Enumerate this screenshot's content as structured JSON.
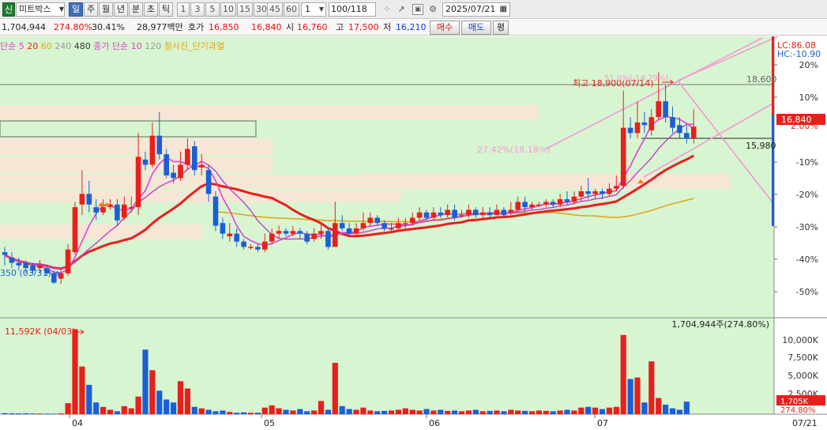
{
  "toolbar": {
    "code_badge": "신",
    "stock_name": "미트박스",
    "periods": [
      "일",
      "주",
      "월",
      "년",
      "분",
      "초",
      "틱"
    ],
    "selected_period": "일",
    "intervals": [
      "1",
      "3",
      "5",
      "10",
      "15",
      "30",
      "45",
      "60"
    ],
    "interval_input": "1",
    "count_value": "100",
    "count_total": "/118",
    "date": "2025/07/21"
  },
  "quote": {
    "volume": "1,704,944",
    "volume_ratio": "274.80%",
    "turnover": "30.41%",
    "amount": "28,977백만",
    "ask_label": "호가",
    "ask": "16,850",
    "bid": "16,840",
    "open_label": "시",
    "open": "16,760",
    "high_label": "고",
    "high": "17,500",
    "low_label": "저",
    "low": "16,210",
    "buy_label": "매수",
    "sell_label": "매도",
    "eval_label": "평"
  },
  "legend": {
    "ma_label": "단순",
    "ma5": "5",
    "ma20": "20",
    "ma60": "60",
    "ma240": "240",
    "ma480": "480",
    "close_ma_label": "종가 단순",
    "ma10": "10",
    "ma120": "120",
    "pattern_label": "청사진_단기과열"
  },
  "chart_data": {
    "type": "candlestick",
    "x_month_labels": [
      "04",
      "05",
      "06",
      "07",
      "07/21"
    ],
    "y_pct_ticks": [
      "20%",
      "10%",
      "2.00%",
      "-10%",
      "-20%",
      "-30%",
      "-40%",
      "-50%"
    ],
    "volume_ticks": [
      "10,000K",
      "7,500K",
      "5,000K",
      "2,500K"
    ],
    "candles": [
      [
        12.1,
        12.0,
        12.3,
        11.6
      ],
      [
        11.9,
        11.7,
        12.1,
        11.5
      ],
      [
        11.7,
        11.6,
        11.9,
        11.4
      ],
      [
        11.7,
        11.5,
        11.8,
        11.3
      ],
      [
        11.6,
        11.4,
        11.7,
        11.3
      ],
      [
        11.5,
        11.6,
        11.8,
        11.3
      ],
      [
        11.5,
        11.3,
        11.6,
        11.2
      ],
      [
        11.3,
        10.95,
        11.4,
        10.9
      ],
      [
        11.1,
        11.3,
        11.5,
        10.9
      ],
      [
        11.3,
        12.2,
        12.4,
        11.2
      ],
      [
        12.1,
        13.8,
        14.0,
        12.0
      ],
      [
        13.9,
        14.3,
        15.2,
        13.5
      ],
      [
        14.3,
        13.9,
        14.8,
        13.6
      ],
      [
        13.8,
        13.6,
        14.1,
        13.3
      ],
      [
        13.6,
        13.8,
        14.1,
        13.5
      ],
      [
        13.8,
        13.9,
        14.1,
        13.7
      ],
      [
        13.9,
        13.3,
        14.1,
        13.1
      ],
      [
        13.4,
        13.9,
        14.2,
        13.3
      ],
      [
        13.8,
        13.8,
        14.2,
        13.6
      ],
      [
        13.8,
        15.7,
        16.6,
        13.5
      ],
      [
        15.6,
        15.4,
        15.9,
        15.2
      ],
      [
        15.4,
        16.5,
        17.0,
        15.3
      ],
      [
        16.5,
        15.8,
        17.4,
        15.6
      ],
      [
        15.8,
        15.0,
        16.0,
        14.9
      ],
      [
        15.1,
        14.9,
        15.4,
        14.7
      ],
      [
        14.9,
        15.4,
        15.9,
        14.8
      ],
      [
        15.4,
        16.0,
        16.4,
        15.2
      ],
      [
        16.1,
        15.2,
        16.3,
        15.0
      ],
      [
        15.3,
        15.4,
        15.8,
        15.0
      ],
      [
        15.2,
        14.3,
        15.4,
        14.0
      ],
      [
        14.2,
        13.1,
        14.4,
        12.9
      ],
      [
        13.2,
        12.8,
        13.4,
        12.6
      ],
      [
        12.7,
        12.8,
        13.2,
        12.5
      ],
      [
        12.8,
        12.5,
        13.0,
        12.3
      ],
      [
        12.5,
        12.3,
        12.6,
        12.2
      ],
      [
        12.3,
        12.3,
        12.4,
        12.2
      ],
      [
        12.3,
        12.2,
        12.4,
        12.1
      ],
      [
        12.2,
        12.5,
        12.8,
        12.1
      ],
      [
        12.5,
        12.8,
        13.0,
        12.4
      ],
      [
        12.8,
        12.9,
        13.1,
        12.6
      ],
      [
        12.9,
        12.8,
        13.0,
        12.7
      ],
      [
        12.8,
        12.9,
        13.1,
        12.7
      ],
      [
        12.9,
        12.8,
        13.0,
        12.6
      ],
      [
        12.8,
        12.5,
        12.9,
        12.4
      ],
      [
        12.6,
        12.8,
        13.0,
        12.5
      ],
      [
        12.8,
        12.9,
        13.2,
        12.6
      ],
      [
        12.9,
        12.3,
        13.0,
        12.2
      ],
      [
        12.3,
        13.2,
        14.0,
        12.3
      ],
      [
        13.2,
        13.0,
        13.5,
        12.9
      ],
      [
        13.0,
        12.8,
        13.2,
        12.7
      ],
      [
        12.8,
        13.0,
        13.2,
        12.7
      ],
      [
        13.0,
        13.2,
        13.6,
        12.9
      ],
      [
        13.2,
        13.4,
        13.6,
        13.1
      ],
      [
        13.4,
        13.2,
        13.5,
        13.1
      ],
      [
        13.2,
        13.0,
        13.3,
        12.9
      ],
      [
        13.0,
        13.0,
        13.2,
        12.9
      ],
      [
        13.0,
        13.2,
        13.4,
        12.9
      ],
      [
        13.2,
        13.2,
        13.4,
        13.0
      ],
      [
        13.2,
        13.4,
        13.6,
        13.1
      ],
      [
        13.4,
        13.6,
        13.8,
        13.3
      ],
      [
        13.6,
        13.4,
        13.7,
        13.3
      ],
      [
        13.4,
        13.6,
        13.8,
        13.3
      ],
      [
        13.6,
        13.5,
        13.8,
        13.4
      ],
      [
        13.5,
        13.7,
        13.9,
        13.4
      ],
      [
        13.7,
        13.4,
        13.9,
        13.3
      ],
      [
        13.5,
        13.5,
        13.7,
        13.4
      ],
      [
        13.5,
        13.7,
        13.9,
        13.4
      ],
      [
        13.7,
        13.5,
        13.8,
        13.4
      ],
      [
        13.5,
        13.6,
        13.8,
        13.4
      ],
      [
        13.6,
        13.5,
        13.8,
        13.4
      ],
      [
        13.5,
        13.7,
        13.9,
        13.5
      ],
      [
        13.7,
        13.5,
        13.8,
        13.4
      ],
      [
        13.6,
        13.7,
        14.0,
        13.5
      ],
      [
        13.7,
        14.0,
        14.2,
        13.6
      ],
      [
        14.0,
        13.8,
        14.2,
        13.6
      ],
      [
        13.8,
        13.9,
        14.0,
        13.7
      ],
      [
        13.9,
        13.9,
        14.0,
        13.8
      ],
      [
        13.9,
        14.0,
        14.1,
        13.8
      ],
      [
        14.0,
        13.9,
        14.1,
        13.8
      ],
      [
        13.9,
        14.1,
        14.3,
        13.8
      ],
      [
        14.1,
        14.0,
        14.4,
        13.9
      ],
      [
        14.0,
        14.2,
        14.4,
        13.9
      ],
      [
        14.2,
        14.4,
        14.6,
        14.0
      ],
      [
        14.4,
        14.3,
        14.9,
        14.1
      ],
      [
        14.3,
        14.4,
        14.5,
        14.1
      ],
      [
        14.4,
        14.3,
        14.5,
        14.1
      ],
      [
        14.3,
        14.5,
        14.7,
        14.2
      ],
      [
        14.5,
        14.6,
        15.0,
        14.4
      ],
      [
        14.6,
        16.8,
        18.2,
        14.5
      ],
      [
        16.8,
        16.6,
        17.2,
        16.4
      ],
      [
        16.6,
        17.0,
        17.8,
        16.4
      ],
      [
        17.0,
        16.9,
        17.4,
        16.6
      ],
      [
        16.7,
        17.2,
        17.5,
        16.5
      ],
      [
        17.2,
        17.8,
        18.9,
        17.1
      ],
      [
        17.8,
        17.2,
        18.4,
        17.0
      ],
      [
        17.2,
        16.8,
        17.6,
        16.6
      ],
      [
        16.9,
        16.6,
        17.2,
        16.4
      ],
      [
        16.6,
        16.4,
        16.9,
        16.2
      ],
      [
        16.4,
        16.84,
        17.5,
        16.21
      ]
    ],
    "volume_k": [
      140,
      120,
      110,
      130,
      100,
      90,
      80,
      70,
      120,
      1500,
      11592,
      6500,
      4000,
      1600,
      1000,
      600,
      400,
      1100,
      800,
      2400,
      8800,
      6000,
      3200,
      2000,
      1600,
      4500,
      3500,
      1000,
      800,
      600,
      400,
      500,
      300,
      200,
      250,
      200,
      200,
      900,
      1200,
      800,
      600,
      500,
      700,
      400,
      500,
      1800,
      600,
      7000,
      1100,
      700,
      600,
      900,
      500,
      400,
      450,
      500,
      600,
      800,
      600,
      500,
      700,
      500,
      600,
      450,
      500,
      400,
      500,
      600,
      400,
      450,
      500,
      400,
      600,
      500,
      450,
      400,
      500,
      450,
      400,
      500,
      600,
      500,
      900,
      1000,
      900,
      700,
      900,
      1000,
      10800,
      4800,
      5000,
      1600,
      7200,
      2200,
      1300,
      800,
      600,
      1705
    ],
    "volume_highlight": "1,704,944주(274.80%)",
    "annotations": {
      "high": "최고 18,900(07/14)",
      "high_ratio": "51.0%(-14.79%)",
      "low": "350 (03/31)",
      "vol_max": "11,592K (04/03)",
      "mid_ratio": "27.42%(18.18%)",
      "hline_value": "18,600",
      "support_value": "15,980",
      "current_price": "16,840",
      "current_pct": "2.00%",
      "lc": "LC:86.08",
      "hc": "HC:-10.90",
      "vol_current": "1,705K",
      "vol_pct": "274.80%"
    }
  },
  "colors": {
    "up": "#e8201c",
    "down": "#1b5fd6",
    "bg": "#d7f5d1",
    "ma5": "#e23fd5",
    "ma20": "#e81f1f",
    "ma60": "#e2a51c",
    "zone": "#f6e6d6"
  }
}
